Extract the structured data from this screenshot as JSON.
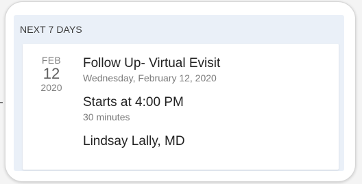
{
  "section": {
    "heading": "NEXT 7 DAYS"
  },
  "appointment": {
    "month": "FEB",
    "day": "12",
    "year": "2020",
    "title": "Follow Up- Virtual Evisit",
    "full_date": "Wednesday, February 12, 2020",
    "start_time": "Starts at 4:00 PM",
    "duration": "30 minutes",
    "provider": "Lindsay Lally, MD"
  },
  "colors": {
    "panel_background": "#eaf0f8",
    "card_background": "#ffffff",
    "primary_text": "#222222",
    "secondary_text": "#7a7a7a"
  }
}
